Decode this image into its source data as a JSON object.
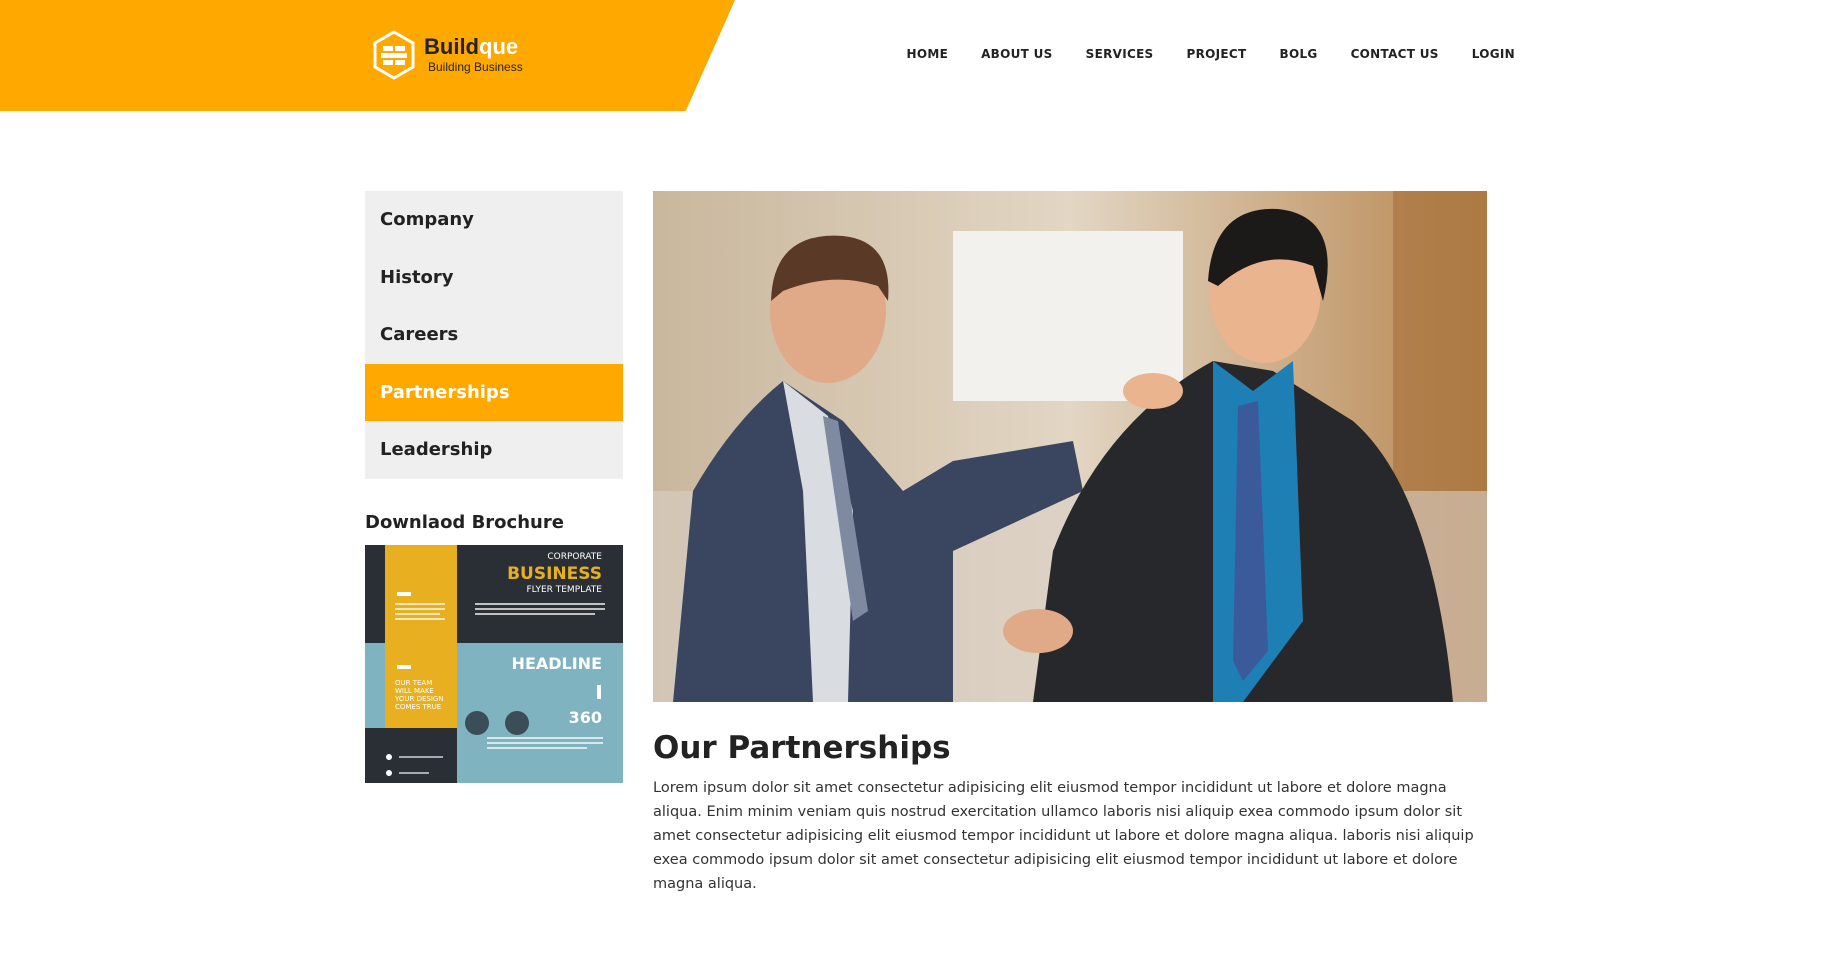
{
  "brand": {
    "name_dark": "Build",
    "name_light": "que",
    "tagline": "Building Business"
  },
  "nav": {
    "items": [
      "HOME",
      "ABOUT US",
      "SERVICES",
      "PROJECT",
      "BOLG",
      "CONTACT US",
      "LOGIN"
    ]
  },
  "sidebar": {
    "items": [
      "Company",
      "History",
      "Careers",
      "Partnerships",
      "Leadership"
    ],
    "active": "Partnerships"
  },
  "brochure": {
    "title": "Downlaod Brochure",
    "flyer": {
      "corporate": "CORPORATE",
      "business": "BUSINESS",
      "flyer_template": "FLYER TEMPLATE",
      "headline": "HEADLINE",
      "number": "360",
      "team_text": [
        "OUR TEAM",
        "WILL MAKE",
        "YOUR DESIGN",
        "COMES TRUE"
      ]
    }
  },
  "main": {
    "title": "Our Partnerships",
    "body": "Lorem ipsum dolor sit amet consectetur adipisicing elit eiusmod tempor incididunt ut labore et dolore magna aliqua. Enim minim veniam quis nostrud exercitation ullamco laboris nisi aliquip exea commodo ipsum dolor sit amet consectetur adipisicing elit eiusmod tempor incididunt ut labore et dolore magna aliqua. laboris nisi aliquip exea commodo ipsum dolor sit amet consectetur adipisicing elit eiusmod tempor incididunt ut labore et dolore magna aliqua."
  },
  "colors": {
    "accent": "#ffa800",
    "sidebar_bg": "#efefef",
    "text": "#222222"
  }
}
